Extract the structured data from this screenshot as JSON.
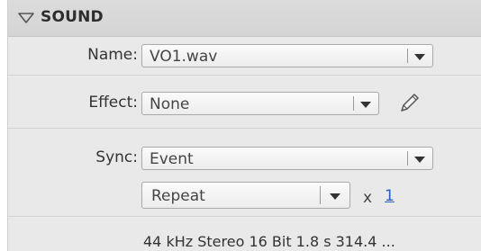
{
  "section": {
    "title": "SOUND",
    "icon": "collapse-triangle-icon"
  },
  "name_row": {
    "label": "Name:",
    "value": "VO1.wav"
  },
  "effect_row": {
    "label": "Effect:",
    "value": "None",
    "edit_icon": "pencil-icon"
  },
  "sync_row": {
    "label": "Sync:",
    "sync_value": "Event",
    "repeat_value": "Repeat",
    "times_symbol": "x",
    "repeat_count": "1"
  },
  "info_text": "44 kHz Stereo 16 Bit 1.8 s 314.4 ..."
}
